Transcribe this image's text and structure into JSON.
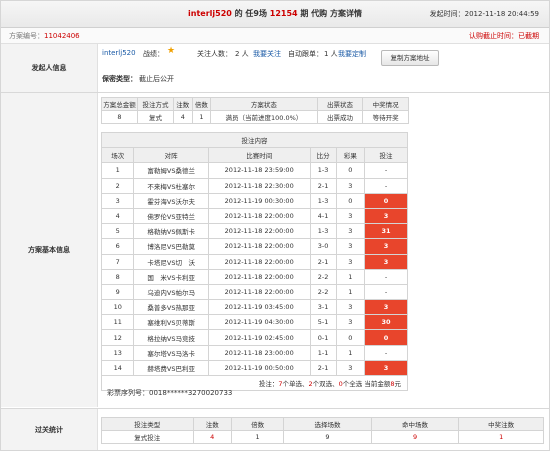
{
  "header": {
    "user": "interlj520",
    "title_mid": " 的 任9场 ",
    "period": "12154",
    "title_end": " 期 代购 方案详情",
    "time_label": "发起时间：",
    "time_value": "2012-11-18 20:44:59"
  },
  "subheader": {
    "plan_no_label": "方案编号：",
    "plan_no": "11042406",
    "status": "认购截止时间：已截期"
  },
  "initiator": {
    "section_label": "发起人信息",
    "user": "interlj520",
    "record_label": "战绩：",
    "followers_label": "关注人数：",
    "followers_value": "2 人",
    "follow_link": "我要关注",
    "auto_label": "自动跟单：",
    "auto_value": "1 人",
    "custom_link": "我要定制",
    "copy_button": "复制方案地址",
    "privacy_label": "保密类型：",
    "privacy_value": "截止后公开",
    "star_icon": "gold-star-icon"
  },
  "basic": {
    "section_label": "方案基本信息",
    "summary_headers": [
      "方案总金额",
      "投注方式",
      "注数",
      "倍数",
      "方案状态",
      "出票状态",
      "中奖情况"
    ],
    "summary_row": [
      "8",
      "复式",
      "4",
      "1",
      "满员（当前进度100.0%）",
      "出票成功",
      "等待开奖"
    ],
    "bet_title": "投注内容",
    "bet_headers": [
      "场次",
      "对阵",
      "比赛时间",
      "比分",
      "彩果",
      "投注"
    ],
    "matches": [
      [
        "1",
        "富勒姆VS桑德兰",
        "2012-11-18 23:59:00",
        "1-3",
        "0",
        "-"
      ],
      [
        "2",
        "不来梅VS杜塞尔",
        "2012-11-18 22:30:00",
        "2-1",
        "3",
        "-"
      ],
      [
        "3",
        "霍芬海VS沃尔夫",
        "2012-11-19 00:30:00",
        "1-3",
        "0",
        "0"
      ],
      [
        "4",
        "佛罗伦VS亚特兰",
        "2012-11-18 22:00:00",
        "4-1",
        "3",
        "3"
      ],
      [
        "5",
        "格勒纳VS佩斯卡",
        "2012-11-18 22:00:00",
        "1-3",
        "3",
        "31"
      ],
      [
        "6",
        "博洛尼VS巴勒莫",
        "2012-11-18 22:00:00",
        "3-0",
        "3",
        "3"
      ],
      [
        "7",
        "卡塔尼VS切　沃",
        "2012-11-18 22:00:00",
        "2-1",
        "3",
        "3"
      ],
      [
        "8",
        "国　米VS卡利亚",
        "2012-11-18 22:00:00",
        "2-2",
        "1",
        "-"
      ],
      [
        "9",
        "乌迪内VS帕尔马",
        "2012-11-18 22:00:00",
        "2-2",
        "1",
        "-"
      ],
      [
        "10",
        "桑普多VS热那亚",
        "2012-11-19 03:45:00",
        "3-1",
        "3",
        "3"
      ],
      [
        "11",
        "塞维利VS贝蒂斯",
        "2012-11-19 04:30:00",
        "5-1",
        "3",
        "30"
      ],
      [
        "12",
        "格拉纳VS马竞技",
        "2012-11-19 02:45:00",
        "0-1",
        "0",
        "0"
      ],
      [
        "13",
        "塞尔塔VS马洛卡",
        "2012-11-18 23:00:00",
        "1-1",
        "1",
        "-"
      ],
      [
        "14",
        "赫塔费VS巴利亚",
        "2012-11-19 00:50:00",
        "2-1",
        "3",
        "3"
      ]
    ],
    "red_bets": [
      false,
      false,
      true,
      true,
      true,
      true,
      true,
      false,
      false,
      true,
      true,
      true,
      false,
      true
    ],
    "footer_prefix": "投注：",
    "footer_7": "7",
    "footer_a": "个单选、",
    "footer_2": "2",
    "footer_b": "个双选、",
    "footer_0": "0",
    "footer_c": "个全选 当前金额",
    "footer_8": "8",
    "footer_d": "元",
    "serial_label": "彩票序列号：",
    "serial_value": "0018******3270020733"
  },
  "stats": {
    "section_label": "过关统计",
    "headers": [
      "投注类型",
      "注数",
      "倍数",
      "选择场数",
      "命中场数",
      "中奖注数"
    ],
    "row": [
      "复式投注",
      "4",
      "1",
      "9",
      "9",
      "1"
    ]
  }
}
